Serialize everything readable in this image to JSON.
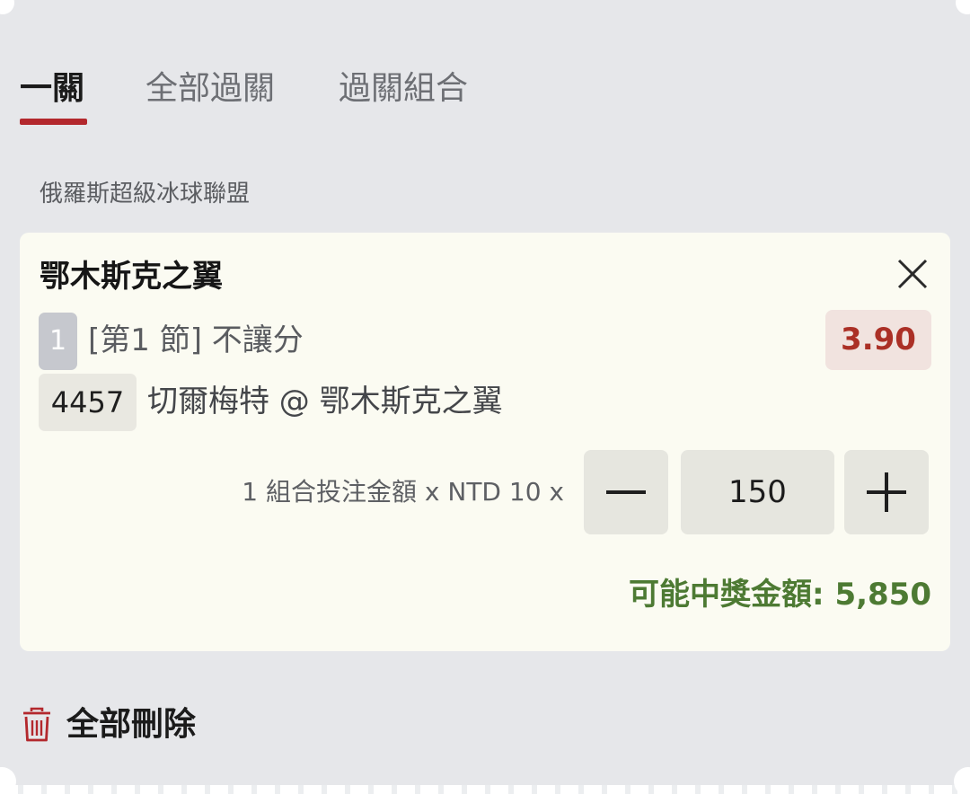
{
  "tabs": [
    {
      "label": "一關",
      "active": true
    },
    {
      "label": "全部過關",
      "active": false
    },
    {
      "label": "過關組合",
      "active": false
    }
  ],
  "league": "俄羅斯超級冰球聯盟",
  "bet": {
    "team": "鄂木斯克之翼",
    "period_badge": "1",
    "market": "[第1 節] 不讓分",
    "odds": "3.90",
    "match_id": "4457",
    "match": "切爾梅特 @ 鄂木斯克之翼",
    "stake_label": "1 組合投注金額 x NTD 10 x",
    "stake_value": "150",
    "payout": "可能中獎金額: 5,850"
  },
  "delete_all_label": "全部刪除",
  "icons": {
    "close": "close-icon",
    "minus": "minus-icon",
    "plus": "plus-icon",
    "trash": "trash-icon"
  },
  "colors": {
    "accent": "#b3282d",
    "odds": "#ab3026",
    "payout": "#4d7a33",
    "background": "#e6e7ea",
    "card": "#fbfbf2"
  }
}
